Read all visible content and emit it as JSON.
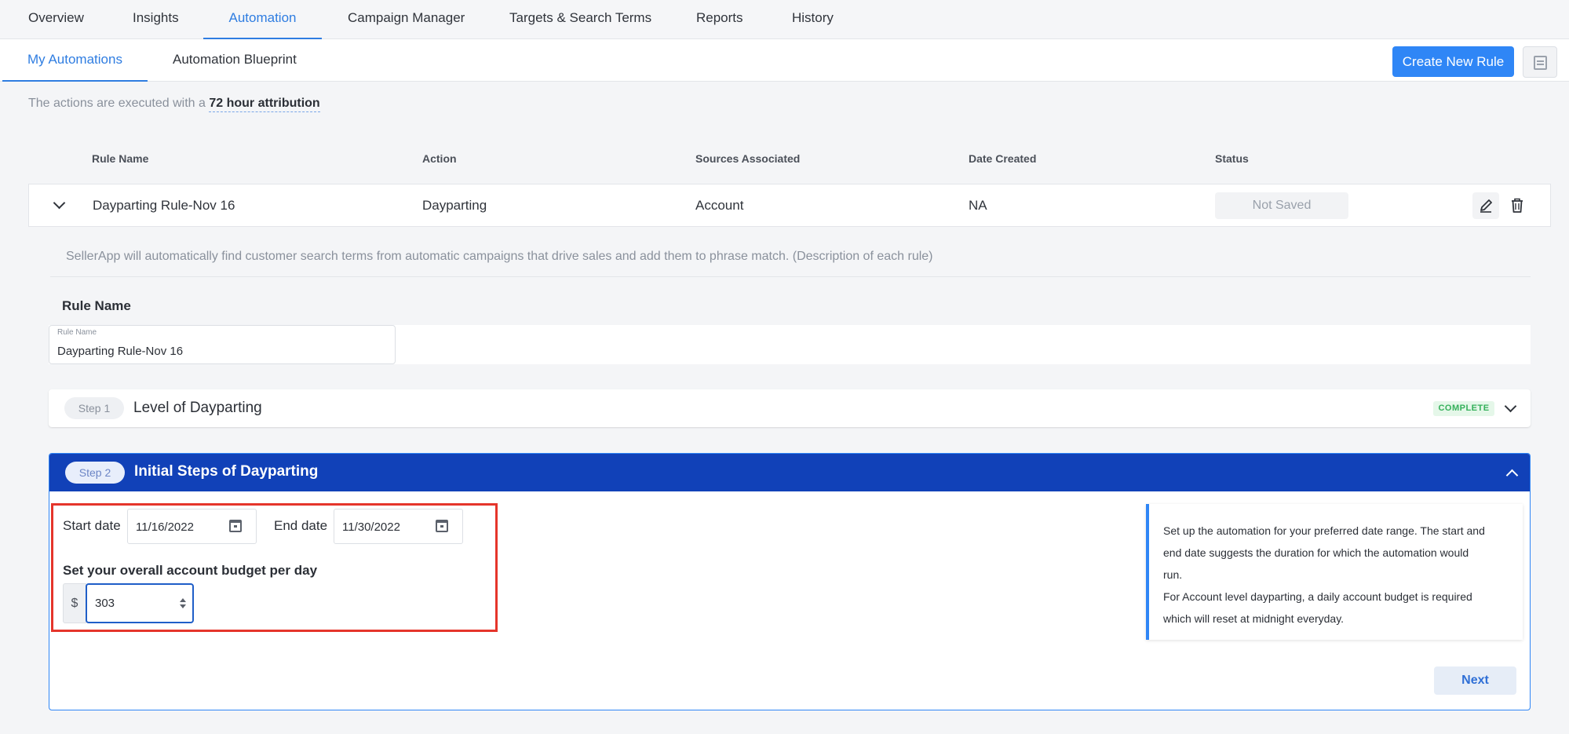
{
  "top_tabs": [
    "Overview",
    "Insights",
    "Automation",
    "Campaign Manager",
    "Targets & Search Terms",
    "Reports",
    "History"
  ],
  "sub_tabs": [
    "My Automations",
    "Automation Blueprint"
  ],
  "create_rule_label": "Create New Rule",
  "attribution": {
    "prefix": "The actions are executed with a",
    "value": "72 hour attribution"
  },
  "table": {
    "headers": [
      "Rule Name",
      "Action",
      "Sources Associated",
      "Date Created",
      "Status"
    ],
    "row": {
      "rule_name": "Dayparting Rule-Nov 16",
      "action": "Dayparting",
      "sources": "Account",
      "date_created": "NA",
      "status": "Not Saved"
    }
  },
  "description": "SellerApp will automatically find customer search terms from automatic campaigns that drive sales and add them to phrase match. (Description of each rule)",
  "rule_name_section": {
    "heading": "Rule Name",
    "field_label": "Rule Name",
    "field_value": "Dayparting Rule-Nov 16"
  },
  "step1": {
    "pill": "Step 1",
    "title": "Level of Dayparting",
    "badge": "COMPLETE"
  },
  "step2": {
    "pill": "Step 2",
    "title": "Initial Steps of Dayparting",
    "start_label": "Start date",
    "start_value": "11/16/2022",
    "end_label": "End date",
    "end_value": "11/30/2022",
    "budget_label": "Set your overall account budget per day",
    "currency": "$",
    "budget_value": "303",
    "info_lines": [
      "Set up the automation for your preferred date range. The start and",
      "end date suggests the duration for which the automation would",
      "run.",
      "For Account level dayparting, a daily account budget is required",
      "which will reset at midnight everyday."
    ],
    "next_label": "Next"
  },
  "colors": {
    "accent": "#2f86f6",
    "step_header": "#1141b8",
    "highlight": "#e5352b",
    "complete": "#34b05a"
  }
}
